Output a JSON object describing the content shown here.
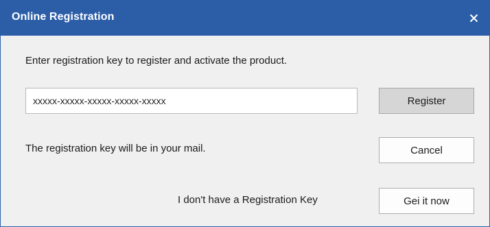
{
  "window": {
    "title": "Online Registration",
    "close_glyph": "✕"
  },
  "instruction": "Enter registration key to register and activate the product.",
  "key_field": {
    "value": "xxxxx-xxxxx-xxxxx-xxxxx-xxxxx",
    "placeholder": ""
  },
  "buttons": {
    "register": "Register",
    "cancel": "Cancel",
    "get_it_now": "Gei it now"
  },
  "mail_note": "The registration key will be in your mail.",
  "no_key_text": "I don't have a Registration Key",
  "colors": {
    "title_bar": "#2c5ea8",
    "title_text": "#ffffff",
    "background": "#f0f0f0",
    "register_button": "#d6d6d6"
  }
}
